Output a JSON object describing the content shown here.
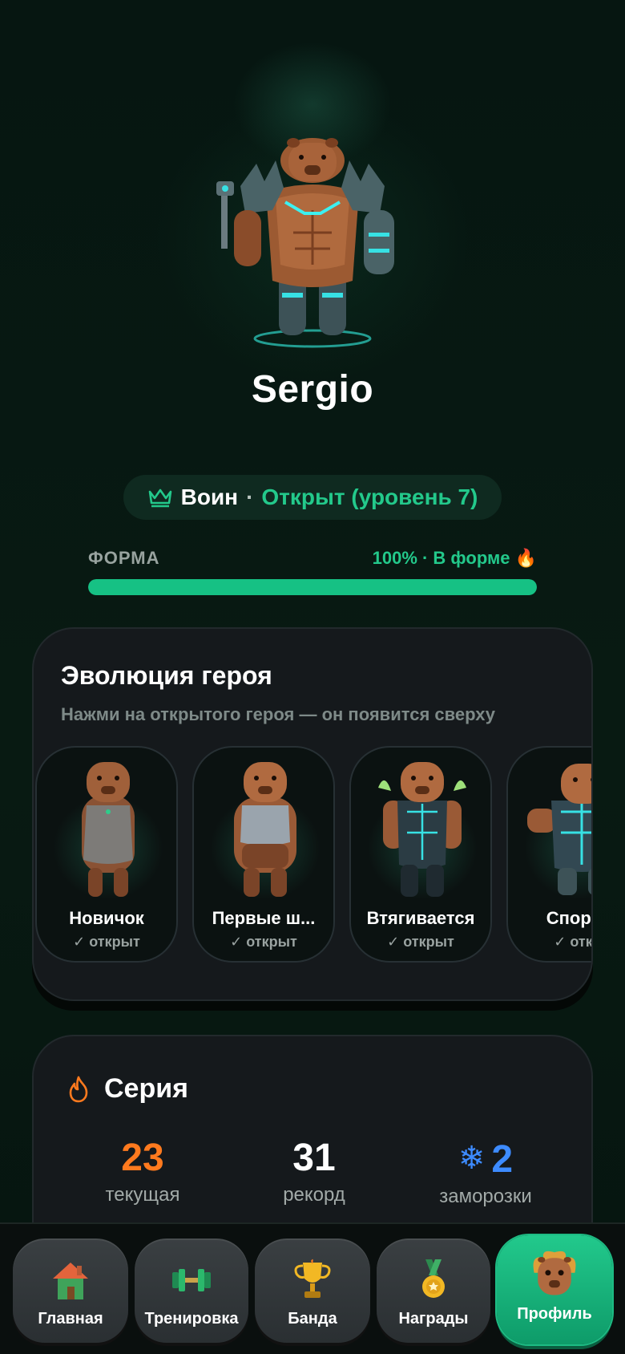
{
  "hero": {
    "name": "Sergio"
  },
  "class_badge": {
    "icon": "crown-icon",
    "name": "Воин",
    "separator": "·",
    "status": "Открыт (уровень 7)"
  },
  "form": {
    "label": "ФОРМА",
    "value_text": "100% · В форме 🔥",
    "progress": 1.0
  },
  "evolution": {
    "title": "Эволюция героя",
    "subtitle": "Нажми на открытого героя — он появится сверху",
    "items": [
      {
        "label": "Новичок",
        "status": "✓ открыт"
      },
      {
        "label": "Первые ш...",
        "status": "✓ открыт"
      },
      {
        "label": "Втягивается",
        "status": "✓ открыт"
      },
      {
        "label": "Спортс",
        "status": "✓ откр"
      }
    ]
  },
  "streak": {
    "icon": "flame-icon",
    "title": "Серия",
    "current": {
      "value": "23",
      "caption": "текущая"
    },
    "record": {
      "value": "31",
      "caption": "рекорд"
    },
    "freezes": {
      "icon": "snowflake-icon",
      "value": "2",
      "caption": "заморозки"
    }
  },
  "nav": {
    "items": [
      {
        "label": "Главная",
        "icon": "house-icon"
      },
      {
        "label": "Тренировка",
        "icon": "dumbbell-icon"
      },
      {
        "label": "Банда",
        "icon": "trophy-icon"
      },
      {
        "label": "Награды",
        "icon": "medal-icon"
      },
      {
        "label": "Профиль",
        "icon": "capybara-avatar-icon"
      }
    ],
    "active": "Профиль"
  },
  "colors": {
    "accent_green": "#23c98b",
    "streak_orange": "#ff7a1e",
    "freeze_blue": "#3d8bff",
    "card_bg": "#15191c",
    "page_bg": "#061510"
  }
}
